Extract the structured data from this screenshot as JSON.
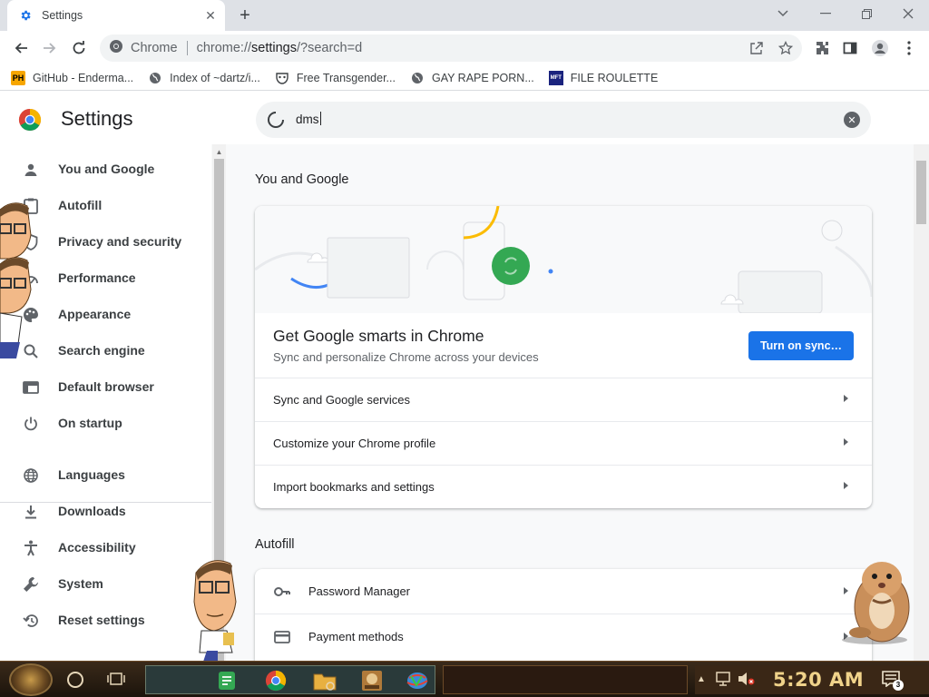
{
  "tab": {
    "title": "Settings",
    "close_glyph": "✕"
  },
  "new_tab_glyph": "+",
  "omnibox": {
    "site_chip": "Chrome",
    "url_scheme": "chrome://",
    "url_host": "settings",
    "url_rest": "/?search=d"
  },
  "bookmarks": [
    {
      "icon": "ph-logo-icon",
      "badge": "PH",
      "label": "GitHub - Enderma..."
    },
    {
      "icon": "globe-icon",
      "label": "Index of ~dartz/i..."
    },
    {
      "icon": "mask-icon",
      "label": "Free Transgender..."
    },
    {
      "icon": "globe-icon",
      "label": "GAY RAPE PORN..."
    },
    {
      "icon": "mft-logo-icon",
      "badge": "MFT",
      "label": "FILE ROULETTE"
    }
  ],
  "settings": {
    "title": "Settings",
    "search_value": "dms"
  },
  "sidebar": {
    "items": [
      {
        "icon": "person-icon",
        "label": "You and Google"
      },
      {
        "icon": "clipboard-icon",
        "label": "Autofill"
      },
      {
        "icon": "shield-icon",
        "label": "Privacy and security"
      },
      {
        "icon": "speedometer-icon",
        "label": "Performance"
      },
      {
        "icon": "palette-icon",
        "label": "Appearance"
      },
      {
        "icon": "search-icon",
        "label": "Search engine"
      },
      {
        "icon": "browser-icon",
        "label": "Default browser"
      },
      {
        "icon": "power-icon",
        "label": "On startup"
      },
      {
        "icon": "globe-icon",
        "label": "Languages"
      },
      {
        "icon": "download-icon",
        "label": "Downloads"
      },
      {
        "icon": "accessibility-icon",
        "label": "Accessibility"
      },
      {
        "icon": "wrench-icon",
        "label": "System"
      },
      {
        "icon": "reset-icon",
        "label": "Reset settings"
      }
    ]
  },
  "main": {
    "you_and_google": {
      "section_title": "You and Google",
      "promo_title": "Get Google smarts in Chrome",
      "promo_subtitle": "Sync and personalize Chrome across your devices",
      "sync_button": "Turn on sync…",
      "rows": [
        "Sync and Google services",
        "Customize your Chrome profile",
        "Import bookmarks and settings"
      ]
    },
    "autofill": {
      "section_title": "Autofill",
      "rows": [
        {
          "icon": "key-icon",
          "label": "Password Manager"
        },
        {
          "icon": "credit-card-icon",
          "label": "Payment methods"
        }
      ]
    }
  },
  "taskbar": {
    "clock": "5:20 AM",
    "notification_count": "3"
  },
  "colors": {
    "accent": "#1a73e8",
    "sync_badge": "#34a853",
    "page_bg": "#f8f9fa"
  }
}
